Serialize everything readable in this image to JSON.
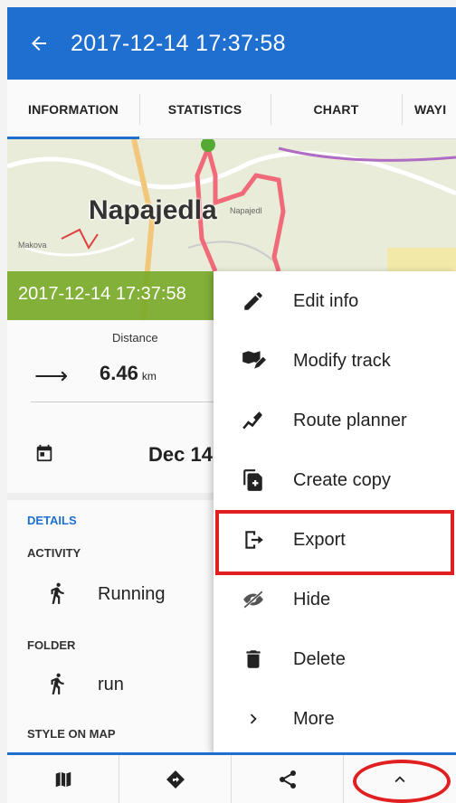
{
  "appbar": {
    "back_icon": "arrow-left-icon",
    "title": "2017-12-14 17:37:58"
  },
  "tabs": [
    {
      "label": "INFORMATION",
      "active": true
    },
    {
      "label": "STATISTICS",
      "active": false
    },
    {
      "label": "CHART",
      "active": false
    },
    {
      "label": "WAYI",
      "active": false
    }
  ],
  "map": {
    "place_label": "Napajedla",
    "date_overlay": "2017-12-14 17:37:58"
  },
  "info": {
    "distance_label": "Distance",
    "distance_value": "6.46",
    "distance_unit": "km",
    "date_value": "Dec 14"
  },
  "details": {
    "heading": "DETAILS",
    "activity_heading": "ACTIVITY",
    "activity_value": "Running",
    "folder_heading": "FOLDER",
    "folder_value": "run",
    "style_heading": "STYLE ON MAP"
  },
  "menu": {
    "items": [
      {
        "label": "Edit info",
        "icon": "pencil-icon"
      },
      {
        "label": "Modify track",
        "icon": "map-edit-icon"
      },
      {
        "label": "Route planner",
        "icon": "route-planner-icon"
      },
      {
        "label": "Create copy",
        "icon": "copy-icon"
      },
      {
        "label": "Export",
        "icon": "export-icon"
      },
      {
        "label": "Hide",
        "icon": "eye-off-icon"
      },
      {
        "label": "Delete",
        "icon": "trash-icon"
      },
      {
        "label": "More",
        "icon": "chevron-right-icon"
      }
    ]
  },
  "bottombar": {
    "buttons": [
      "map-icon",
      "navigate-icon",
      "share-icon",
      "chevron-up-icon"
    ]
  },
  "colors": {
    "primary": "#1f6fd1",
    "highlight": "#e02020",
    "map_overlay": "#78aa28"
  }
}
